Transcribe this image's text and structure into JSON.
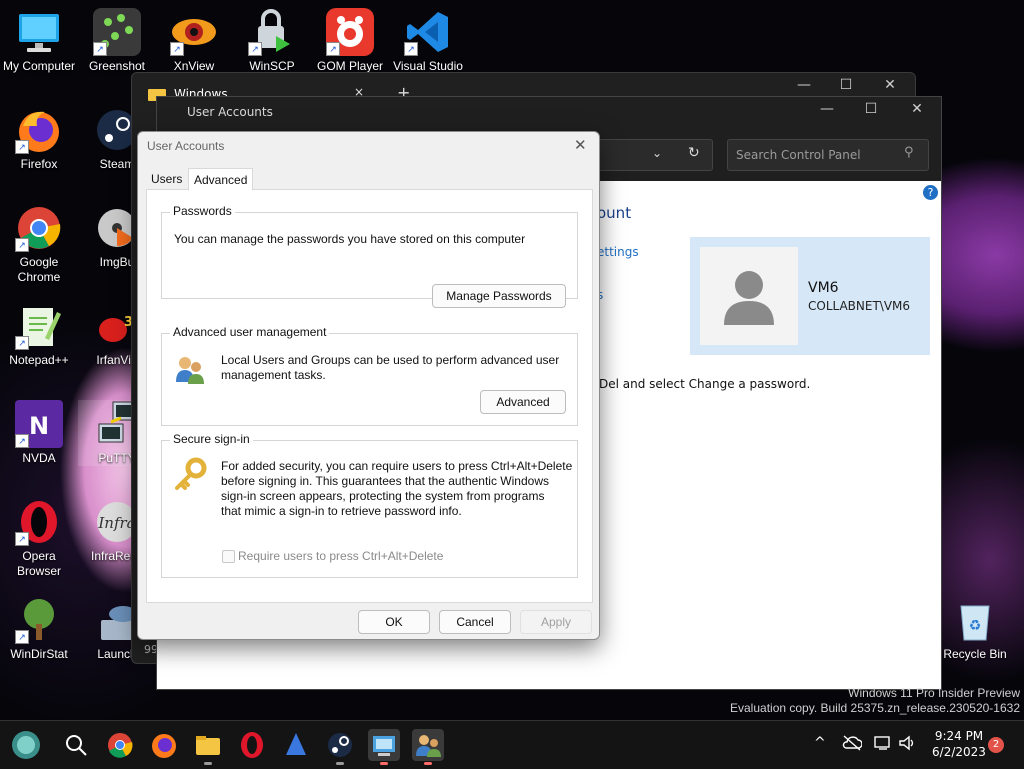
{
  "desktop": {
    "icons": [
      {
        "label": "My Computer",
        "icon": "monitor-icon"
      },
      {
        "label": "Greenshot",
        "icon": "greenshot-icon"
      },
      {
        "label": "XnView",
        "icon": "xnview-icon"
      },
      {
        "label": "WinSCP",
        "icon": "winscp-icon"
      },
      {
        "label": "GOM Player",
        "icon": "gom-player-icon"
      },
      {
        "label": "Visual Studio",
        "icon": "vscode-icon"
      },
      {
        "label": "Firefox",
        "icon": "firefox-icon"
      },
      {
        "label": "Steam",
        "icon": "steam-icon"
      },
      {
        "label": "Google Chrome",
        "icon": "chrome-icon"
      },
      {
        "label": "ImgBu",
        "icon": "imgburn-icon"
      },
      {
        "label": "Notepad++",
        "icon": "notepadpp-icon"
      },
      {
        "label": "IrfanVie",
        "icon": "irfanview-icon"
      },
      {
        "label": "NVDA",
        "icon": "nvda-icon"
      },
      {
        "label": "PuTTY",
        "icon": "putty-icon"
      },
      {
        "label": "Opera Browser",
        "icon": "opera-icon"
      },
      {
        "label": "InfraReco",
        "icon": "infrarecorder-icon"
      },
      {
        "label": "WinDirStat",
        "icon": "windirstat-icon"
      },
      {
        "label": "Launch",
        "icon": "launch-icon"
      },
      {
        "label": "Recycle Bin",
        "icon": "recycle-bin-icon"
      }
    ],
    "watermark_line1": "Windows 11 Pro Insider Preview",
    "watermark_line2": "Evaluation copy. Build 25375.zn_release.230520-1632"
  },
  "explorer": {
    "tab_title": "Windows",
    "tab_close": "×",
    "new_tab": "+",
    "status_fragment": "99"
  },
  "control_panel": {
    "title": "User Accounts",
    "search_placeholder": "Search Control Panel",
    "heading_fragment": "ount",
    "link1_fragment": "ettings",
    "link2_fragment": "s",
    "account_name": "VM6",
    "account_domain": "COLLABNET\\VM6",
    "body_fragment": "Del and select Change a password.",
    "help": "?"
  },
  "dialog": {
    "title": "User Accounts",
    "close": "✕",
    "tabs": [
      {
        "label": "Users"
      },
      {
        "label": "Advanced"
      }
    ],
    "passwords": {
      "label": "Passwords",
      "text": "You can manage the passwords you have stored on this computer",
      "button": "Manage Passwords"
    },
    "advanced_mgmt": {
      "label": "Advanced user management",
      "text_line1": "Local Users and Groups can be used to perform advanced user",
      "text_line2": "management tasks.",
      "button": "Advanced"
    },
    "secure_signin": {
      "label": "Secure sign-in",
      "text_line1": "For added security, you can require users to press Ctrl+Alt+Delete",
      "text_line2": "before signing in. This guarantees that the authentic Windows",
      "text_line3": "sign-in screen appears, protecting the system from programs",
      "text_line4": "that mimic a sign-in to retrieve password info.",
      "checkbox_label": "Require users to press Ctrl+Alt+Delete",
      "checked": false
    },
    "buttons": {
      "ok": "OK",
      "cancel": "Cancel",
      "apply": "Apply"
    }
  },
  "taskbar": {
    "time": "9:24 PM",
    "date": "6/2/2023",
    "notification_count": "2",
    "tray_chevron": "^"
  }
}
